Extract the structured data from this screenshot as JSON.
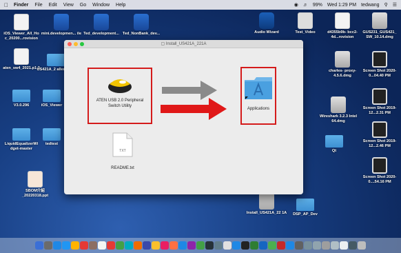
{
  "menubar": {
    "apple_icon": "apple-icon",
    "items": [
      "Finder",
      "File",
      "Edit",
      "View",
      "Go",
      "Window",
      "Help"
    ],
    "battery": "99%",
    "clock": "Wed 1:29 PM",
    "user": "tedwang"
  },
  "desktop_left": [
    {
      "label": "PROV",
      "icon": "app-icon"
    },
    {
      "label": "iOS_Viewer_All_Ho c_20200...rovision",
      "icon": "prov-icon"
    },
    {
      "label": "mini.developmen... ile",
      "icon": "xcode-icon"
    },
    {
      "label": "Ted_development...",
      "icon": "xcode-icon"
    },
    {
      "label": "Ted_NonBank_dev...",
      "icon": "xcode-icon"
    },
    {
      "label": "aten_sw4_2021.p1 2",
      "icon": "certificate-icon"
    },
    {
      "label": "US421A_2 aller_V1.2",
      "icon": "folder-icon"
    },
    {
      "label": "V3.0.296",
      "icon": "folder-icon"
    },
    {
      "label": "iOS_Viewer",
      "icon": "folder-icon"
    },
    {
      "label": "LiquidEqualizerWi dget-master",
      "icon": "folder-icon"
    },
    {
      "label": "tedtest",
      "icon": "folder-icon"
    },
    {
      "label": "SBOM介紹 _20220318.ppt",
      "icon": "ppt-icon"
    }
  ],
  "desktop_right": [
    {
      "label": "Audio Wizard"
    },
    {
      "label": "Test_Video"
    },
    {
      "label": "d4355b9b- bcc2-4d...rovision"
    },
    {
      "label": "GUS231_GUS421_ SW_10.14.dmg"
    },
    {
      "label": "charles- proxy-4.5.6.dmg"
    },
    {
      "label": "Screen Shot 2020-0...04.40 PM"
    },
    {
      "label": "Screen Shot 2019-12...2.31 PM"
    },
    {
      "label": "Wireshark 3.2.3 Intel 64.dmg"
    },
    {
      "label": "Screen Shot 2019-12...2.46 PM"
    },
    {
      "label": "Qt"
    },
    {
      "label": "Screen Shot 2020-0....54.16 PM"
    },
    {
      "label": "Install_US421A_22 1A"
    },
    {
      "label": "DSP_AP_Dev"
    }
  ],
  "window": {
    "title": "Install_US421A_221A",
    "app_label": "ATEN USB 2.0 Peripheral Switch Utility",
    "applications_label": "Applications",
    "readme_label": "README.txt",
    "readme_badge": "TXT"
  },
  "colors": {
    "highlight": "#d41a1a",
    "arrow_red": "#e01818",
    "arrow_gray": "#8a8a8a"
  }
}
